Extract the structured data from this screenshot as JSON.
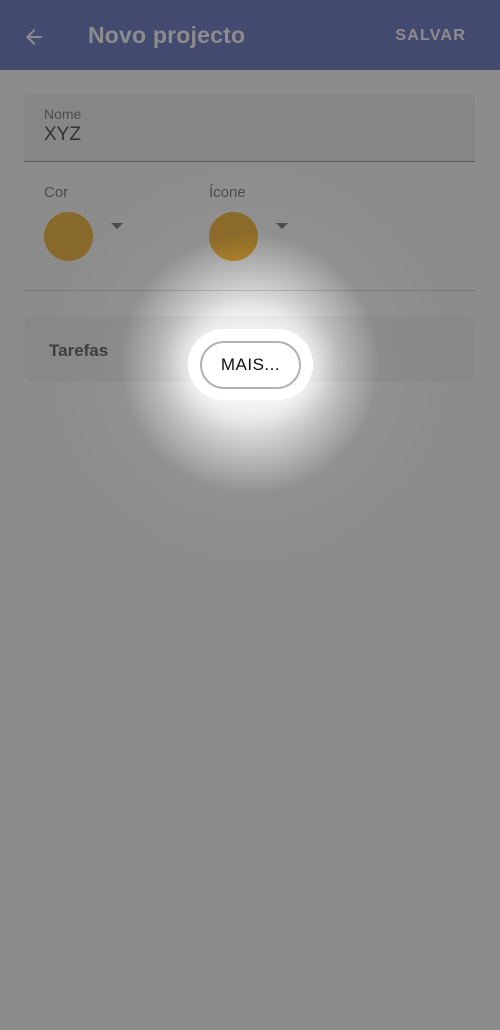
{
  "app_bar": {
    "title": "Novo projecto",
    "save_label": "SALVAR",
    "back_icon": "arrow-left-icon",
    "background": "#3f51b5"
  },
  "form": {
    "name": {
      "label": "Nome",
      "value": "XYZ"
    },
    "color_picker": {
      "label": "Cor",
      "selected_color": "#f5a300"
    },
    "icon_picker": {
      "label": "Ícone",
      "selected_color": "#f5a300"
    }
  },
  "tasks": {
    "heading": "Tarefas"
  },
  "tutorial": {
    "more_label": "MAIS..."
  }
}
